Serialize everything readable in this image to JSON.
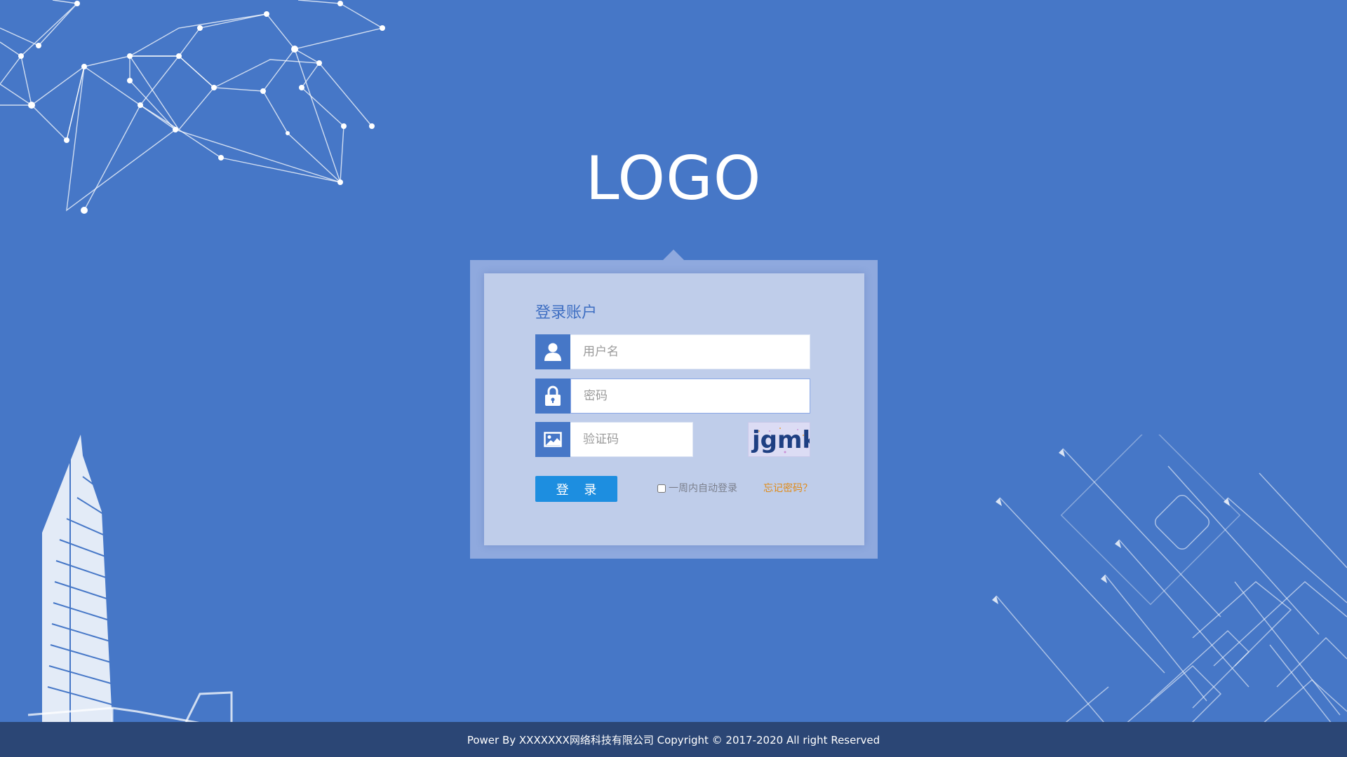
{
  "page": {
    "logo": "LOGO",
    "background_color": "#4677c7"
  },
  "login": {
    "title": "登录账户",
    "username_placeholder": "用户名",
    "password_placeholder": "密码",
    "captcha_placeholder": "验证码",
    "captcha_text": "jgmkj",
    "submit_label": "登 录",
    "remember_label": "一周内自动登录",
    "forgot_label": "忘记密码？",
    "accent_color": "#1d8ee0",
    "link_color": "#e08a17"
  },
  "footer": {
    "text": "Power By XXXXXXX网络科技有限公司  Copyright © 2017-2020 All right Reserved"
  },
  "icons": {
    "username": "user-icon",
    "password": "lock-icon",
    "captcha": "image-icon"
  }
}
